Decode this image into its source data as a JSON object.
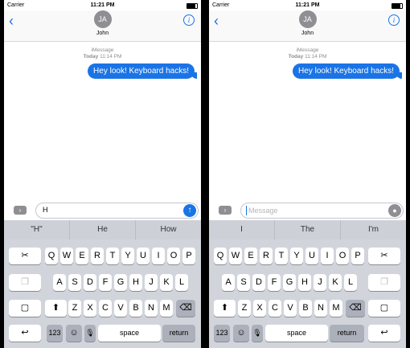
{
  "status": {
    "carrier": "Carrier",
    "time": "11:21 PM"
  },
  "header": {
    "back_icon": "‹",
    "avatar_initials": "JA",
    "contact_name": "John",
    "info_icon": "i"
  },
  "thread": {
    "service": "iMessage",
    "timestamp_prefix": "Today",
    "timestamp": "11:14 PM",
    "message": "Hey look! Keyboard hacks!"
  },
  "left": {
    "input_value": "H",
    "predictions": [
      "\"H\"",
      "He",
      "How"
    ]
  },
  "right": {
    "input_placeholder": "Message",
    "predictions": [
      "I",
      "The",
      "I'm"
    ]
  },
  "keyboard": {
    "row1": [
      "Q",
      "W",
      "E",
      "R",
      "T",
      "Y",
      "U",
      "I",
      "O",
      "P"
    ],
    "row2": [
      "A",
      "S",
      "D",
      "F",
      "G",
      "H",
      "J",
      "K",
      "L"
    ],
    "row3": [
      "Z",
      "X",
      "C",
      "V",
      "B",
      "N",
      "M"
    ],
    "numbers_label": "123",
    "space_label": "space",
    "return_label": "return",
    "icons": {
      "scissors": "✂",
      "copy": "❐",
      "paste": "▢",
      "shift": "⬆",
      "backspace": "⌫",
      "undo": "↩",
      "emoji": "☺",
      "mic": "🎙"
    }
  }
}
